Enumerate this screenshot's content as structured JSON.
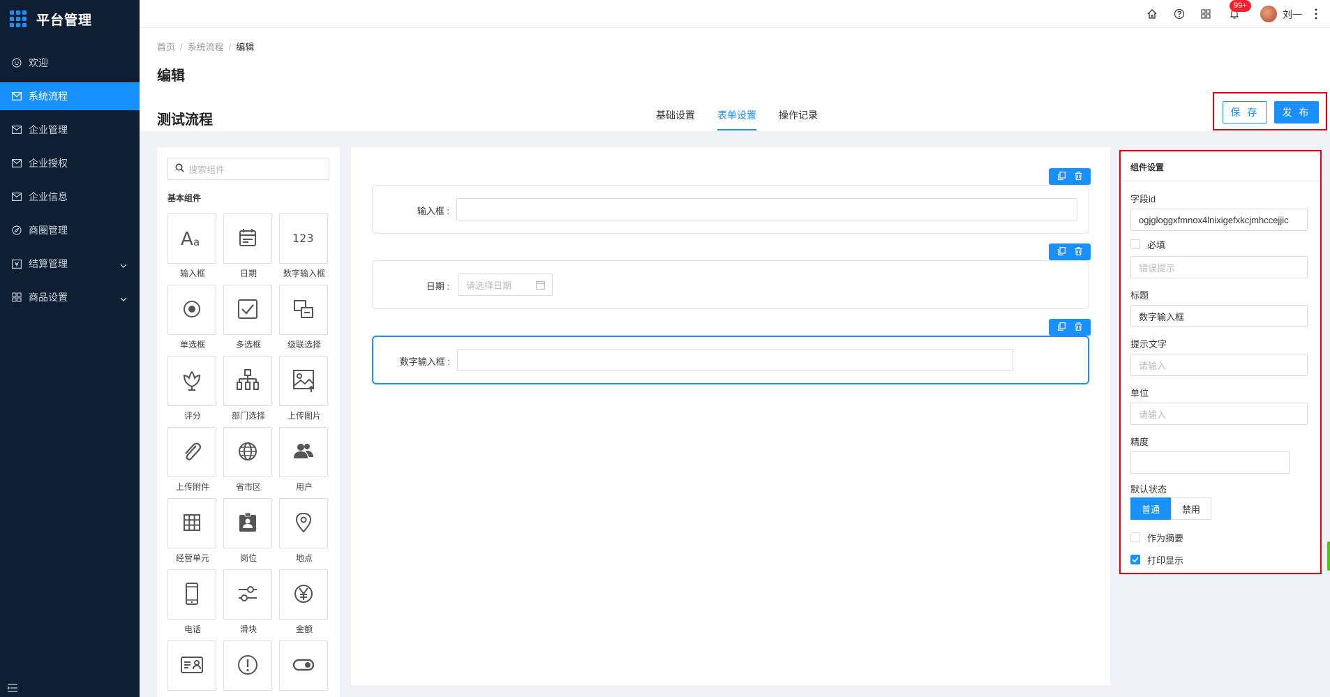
{
  "app": {
    "title": "平台管理"
  },
  "sidebar": {
    "items": [
      {
        "label": "欢迎",
        "icon": "smile-icon"
      },
      {
        "label": "系统流程",
        "icon": "mail-icon",
        "active": true
      },
      {
        "label": "企业管理",
        "icon": "mail-icon"
      },
      {
        "label": "企业授权",
        "icon": "mail-icon"
      },
      {
        "label": "企业信息",
        "icon": "mail-icon"
      },
      {
        "label": "商圈管理",
        "icon": "compass-icon"
      },
      {
        "label": "结算管理",
        "icon": "settlement-icon",
        "expandable": true
      },
      {
        "label": "商品设置",
        "icon": "grid-icon",
        "expandable": true
      }
    ]
  },
  "topbar": {
    "notification_badge": "99+",
    "username": "刘一"
  },
  "breadcrumb": {
    "items": [
      "首页",
      "系统流程"
    ],
    "current": "编辑"
  },
  "page": {
    "title": "编辑",
    "flow_name": "测试流程"
  },
  "tabs": [
    {
      "label": "基础设置",
      "active": false
    },
    {
      "label": "表单设置",
      "active": true
    },
    {
      "label": "操作记录",
      "active": false
    }
  ],
  "actions": {
    "save": "保 存",
    "publish": "发 布"
  },
  "palette": {
    "search_placeholder": "搜索组件",
    "section_label": "基本组件",
    "components": [
      {
        "label": "输入框",
        "icon": "text-input-icon"
      },
      {
        "label": "日期",
        "icon": "calendar-icon"
      },
      {
        "label": "数字输入框",
        "icon": "number-icon"
      },
      {
        "label": "单选框",
        "icon": "radio-icon"
      },
      {
        "label": "多选框",
        "icon": "checkbox-icon"
      },
      {
        "label": "级联选择",
        "icon": "cascade-icon"
      },
      {
        "label": "评分",
        "icon": "flower-icon"
      },
      {
        "label": "部门选择",
        "icon": "org-chart-icon"
      },
      {
        "label": "上传图片",
        "icon": "image-upload-icon"
      },
      {
        "label": "上传附件",
        "icon": "paperclip-icon"
      },
      {
        "label": "省市区",
        "icon": "globe-icon"
      },
      {
        "label": "用户",
        "icon": "users-icon"
      },
      {
        "label": "经营单元",
        "icon": "table-grid-icon"
      },
      {
        "label": "岗位",
        "icon": "badge-icon"
      },
      {
        "label": "地点",
        "icon": "location-pin-icon"
      },
      {
        "label": "电话",
        "icon": "phone-icon"
      },
      {
        "label": "滑块",
        "icon": "slider-icon"
      },
      {
        "label": "金额",
        "icon": "yen-icon"
      },
      {
        "label": "",
        "icon": "id-card-icon"
      },
      {
        "label": "",
        "icon": "alert-icon"
      },
      {
        "label": "",
        "icon": "toggle-icon"
      }
    ]
  },
  "form_fields": [
    {
      "label": "输入框 :",
      "type": "text"
    },
    {
      "label": "日期 :",
      "type": "date",
      "placeholder": "请选择日期"
    },
    {
      "label": "数字输入框 :",
      "type": "number",
      "selected": true
    }
  ],
  "settings": {
    "title": "组件设置",
    "field_id_label": "字段id",
    "field_id_value": "ogjgloggxfmnox4lnixigefxkcjmhccejjic",
    "required_label": "必填",
    "error_placeholder": "错误提示",
    "title_label": "标题",
    "title_value": "数字输入框",
    "hint_label": "提示文字",
    "hint_placeholder": "请输入",
    "unit_label": "单位",
    "unit_placeholder": "请输入",
    "precision_label": "精度",
    "precision_value": "",
    "default_state_label": "默认状态",
    "state_options": [
      "普通",
      "禁用"
    ],
    "state_selected": "普通",
    "summary_label": "作为摘要",
    "summary_checked": false,
    "print_label": "打印显示",
    "print_checked": true
  },
  "colors": {
    "primary": "#1890ff",
    "sidebar_bg": "#0e1f33",
    "highlight_border": "#e50012",
    "badge": "#f5222d"
  }
}
